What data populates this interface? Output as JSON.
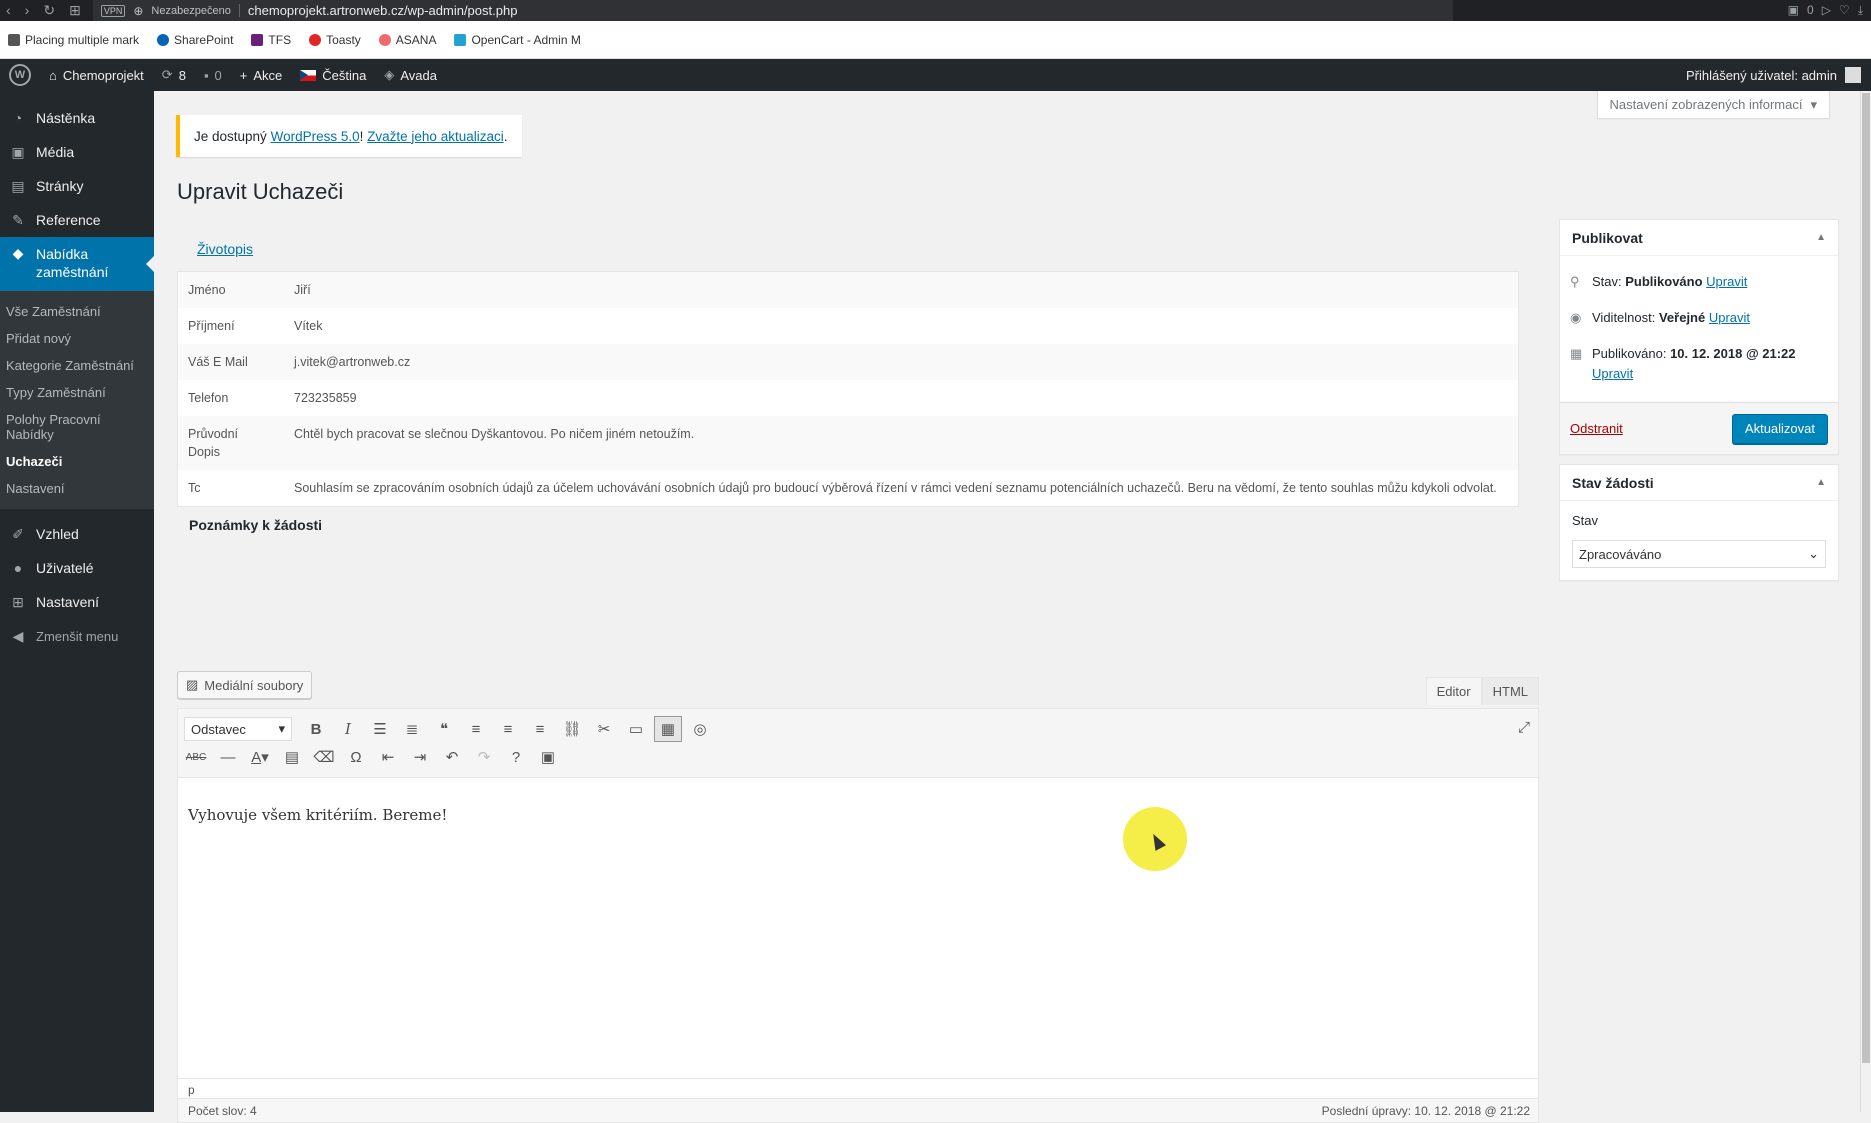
{
  "browser": {
    "vpn": "VPN",
    "insecure": "Nezabezpečeno",
    "url": "chemoprojekt.artronweb.cz/wp-admin/post.php",
    "badge_count": "0"
  },
  "bookmarks": [
    {
      "label": "Placing multiple mark",
      "color": "#555"
    },
    {
      "label": "SharePoint",
      "color": "#0364b8"
    },
    {
      "label": "TFS",
      "color": "#68217a"
    },
    {
      "label": "Toasty",
      "color": "#e1262a"
    },
    {
      "label": "ASANA",
      "color": "#f06a6a"
    },
    {
      "label": "OpenCart - Admin M",
      "color": "#23a1d1"
    }
  ],
  "adminbar": {
    "site": "Chemoprojekt",
    "updates": "8",
    "comments": "0",
    "new": "Akce",
    "language": "Čeština",
    "theme": "Avada",
    "user": "Přihlášený uživatel: admin"
  },
  "sidebar": {
    "items_top": [
      "Nástěnka",
      "Média",
      "Stránky",
      "Reference"
    ],
    "current": "Nabídka zaměstnání",
    "submenu": [
      "Vše Zaměstnání",
      "Přidat nový",
      "Kategorie Zaměstnání",
      "Typy Zaměstnání",
      "Polohy Pracovní Nabídky",
      "Uchazeči",
      "Nastavení"
    ],
    "items_bottom": [
      "Vzhled",
      "Uživatelé",
      "Nastavení"
    ],
    "collapse": "Zmenšit menu"
  },
  "screen_options": "Nastavení zobrazených informací",
  "notice": {
    "text_before": "Je dostupný ",
    "link1": "WordPress 5.0",
    "text_mid": "! ",
    "link2": "Zvažte jeho aktualizaci",
    "text_after": "."
  },
  "page_title": "Upravit Uchazeči",
  "tab": "Životopis",
  "fields": [
    {
      "key": "Jméno",
      "value": "Jiří"
    },
    {
      "key": "Příjmení",
      "value": "Vítek"
    },
    {
      "key": "Váš E Mail",
      "value": "j.vitek@artronweb.cz"
    },
    {
      "key": "Telefon",
      "value": "723235859"
    },
    {
      "key": "Průvodní Dopis",
      "value": "Chtěl bych pracovat se slečnou Dyškantovou. Po ničem jiném netoužím."
    },
    {
      "key": "Tc",
      "value": "Souhlasím se zpracováním osobních údajů za účelem uchovávání osobních údajů pro budoucí výběrová řízení v rámci vedení seznamu potenciálních uchazečů. Beru na vědomí, že tento souhlas můžu kdykoli odvolat."
    }
  ],
  "notes_heading": "Poznámky k žádosti",
  "editor": {
    "media_button": "Mediální soubory",
    "tab_visual": "Editor",
    "tab_html": "HTML",
    "format": "Odstavec",
    "content": "Vyhovuje všem kritériím. Bereme!",
    "path": "p",
    "word_count": "Počet slov: 4",
    "last_edit": "Poslední úpravy: 10. 12. 2018 @ 21:22"
  },
  "publish": {
    "title": "Publikovat",
    "status_label": "Stav: ",
    "status_value": "Publikováno",
    "visibility_label": "Viditelnost: ",
    "visibility_value": "Veřejné",
    "published_label": "Publikováno: ",
    "published_value": "10. 12. 2018 @ 21:22",
    "edit": "Upravit",
    "delete": "Odstranit",
    "update": "Aktualizovat"
  },
  "stav_box": {
    "title": "Stav žádosti",
    "label": "Stav",
    "selected": "Zpracováváno"
  },
  "colors": {
    "accent": "#0073aa",
    "primary_button": "#0085ba",
    "admin_dark": "#23282d",
    "notice_warning": "#ffb900"
  }
}
